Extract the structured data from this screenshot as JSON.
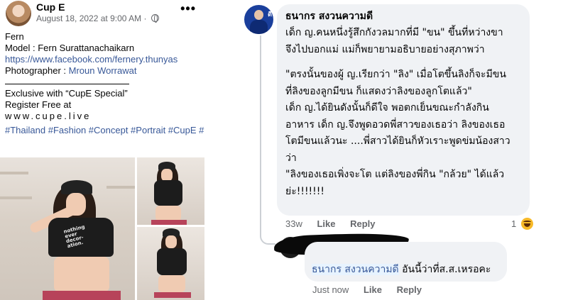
{
  "post": {
    "page_name": "Cup E",
    "date": "August 18, 2022 at 9:00 AM",
    "dot_separator": "·",
    "more_label": "•••",
    "lines": {
      "name": "Fern",
      "model": "Model : Fern Surattanachaikarn",
      "link": "https://www.facebook.com/fernery.thunyas",
      "photographer_prefix": "Photographer : ",
      "photographer_name": "Mroun Worrawat",
      "exclusive": "Exclusive with “CupE Special”",
      "register": "Register Free at",
      "site": "www.cupe.live",
      "hashtags": "#Thailand #Fashion #Concept #Portrait #CupE #CupELive"
    },
    "shirt_text": "nothing\never\ndecor-\nation."
  },
  "comment": {
    "author": "ธนากร สงวนความดี",
    "avatar_badge": "ดี",
    "lines": [
      "เด็ก ญ.คนหนึ่งรู้สึกกังวลมากที่มี \"ขน\" ขึ้นที่หว่างขา",
      "จึงไปบอกแม่ แม่ก็พยายามอธิบายอย่างสุภาพว่า",
      "",
      "\"ตรงนั้นของผู้ ญ.เรียกว่า \"ลิง\" เมื่อโตขึ้นลิงก็จะมีขน",
      "ที่ลิงของลูกมีขน ก็แสดงว่าลิงของลูกโตแล้ว\"",
      "เด็ก ญ.ได้ยินดังนั้นก็ดีใจ พอตกเย็นขณะกำลังกิน",
      "อาหาร เด็ก ญ.จึงพูดอวดพี่สาวของเธอว่า ลิงของเธอ",
      "โตมีขนแล้วนะ ....พี่สาวได้ยินก็หัวเราะพูดข่มน้องสาว",
      "ว่า",
      "\"ลิงของเธอเพิ่งจะโต แต่ลิงของพี่กิน \"กล้วย\" ได้แล้ว",
      "ย่ะ!!!!!!!"
    ],
    "time": "33w",
    "like_label": "Like",
    "reply_label": "Reply",
    "reaction_count": "1",
    "reaction_icon": "haha-icon"
  },
  "reply": {
    "mention": "ธนากร สงวนความดี",
    "text": " อันนี้ว่าที่ส.ส.เหรอคะ",
    "time": "Just now",
    "like_label": "Like",
    "reply_label": "Reply"
  },
  "colors": {
    "link": "#385898",
    "bubble": "#f0f2f5",
    "meta": "#65676b",
    "haha": "#f7b928"
  }
}
